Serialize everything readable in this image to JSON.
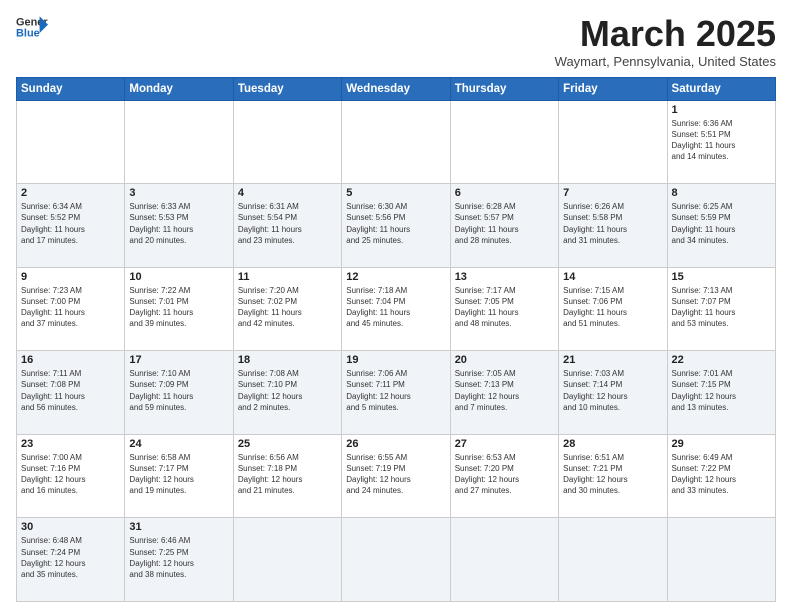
{
  "header": {
    "logo_line1": "General",
    "logo_line2": "Blue",
    "month_title": "March 2025",
    "location": "Waymart, Pennsylvania, United States"
  },
  "days_of_week": [
    "Sunday",
    "Monday",
    "Tuesday",
    "Wednesday",
    "Thursday",
    "Friday",
    "Saturday"
  ],
  "weeks": [
    {
      "days": [
        {
          "num": "",
          "info": ""
        },
        {
          "num": "",
          "info": ""
        },
        {
          "num": "",
          "info": ""
        },
        {
          "num": "",
          "info": ""
        },
        {
          "num": "",
          "info": ""
        },
        {
          "num": "",
          "info": ""
        },
        {
          "num": "1",
          "info": "Sunrise: 6:36 AM\nSunset: 5:51 PM\nDaylight: 11 hours\nand 14 minutes."
        }
      ]
    },
    {
      "days": [
        {
          "num": "2",
          "info": "Sunrise: 6:34 AM\nSunset: 5:52 PM\nDaylight: 11 hours\nand 17 minutes."
        },
        {
          "num": "3",
          "info": "Sunrise: 6:33 AM\nSunset: 5:53 PM\nDaylight: 11 hours\nand 20 minutes."
        },
        {
          "num": "4",
          "info": "Sunrise: 6:31 AM\nSunset: 5:54 PM\nDaylight: 11 hours\nand 23 minutes."
        },
        {
          "num": "5",
          "info": "Sunrise: 6:30 AM\nSunset: 5:56 PM\nDaylight: 11 hours\nand 25 minutes."
        },
        {
          "num": "6",
          "info": "Sunrise: 6:28 AM\nSunset: 5:57 PM\nDaylight: 11 hours\nand 28 minutes."
        },
        {
          "num": "7",
          "info": "Sunrise: 6:26 AM\nSunset: 5:58 PM\nDaylight: 11 hours\nand 31 minutes."
        },
        {
          "num": "8",
          "info": "Sunrise: 6:25 AM\nSunset: 5:59 PM\nDaylight: 11 hours\nand 34 minutes."
        }
      ]
    },
    {
      "days": [
        {
          "num": "9",
          "info": "Sunrise: 7:23 AM\nSunset: 7:00 PM\nDaylight: 11 hours\nand 37 minutes."
        },
        {
          "num": "10",
          "info": "Sunrise: 7:22 AM\nSunset: 7:01 PM\nDaylight: 11 hours\nand 39 minutes."
        },
        {
          "num": "11",
          "info": "Sunrise: 7:20 AM\nSunset: 7:02 PM\nDaylight: 11 hours\nand 42 minutes."
        },
        {
          "num": "12",
          "info": "Sunrise: 7:18 AM\nSunset: 7:04 PM\nDaylight: 11 hours\nand 45 minutes."
        },
        {
          "num": "13",
          "info": "Sunrise: 7:17 AM\nSunset: 7:05 PM\nDaylight: 11 hours\nand 48 minutes."
        },
        {
          "num": "14",
          "info": "Sunrise: 7:15 AM\nSunset: 7:06 PM\nDaylight: 11 hours\nand 51 minutes."
        },
        {
          "num": "15",
          "info": "Sunrise: 7:13 AM\nSunset: 7:07 PM\nDaylight: 11 hours\nand 53 minutes."
        }
      ]
    },
    {
      "days": [
        {
          "num": "16",
          "info": "Sunrise: 7:11 AM\nSunset: 7:08 PM\nDaylight: 11 hours\nand 56 minutes."
        },
        {
          "num": "17",
          "info": "Sunrise: 7:10 AM\nSunset: 7:09 PM\nDaylight: 11 hours\nand 59 minutes."
        },
        {
          "num": "18",
          "info": "Sunrise: 7:08 AM\nSunset: 7:10 PM\nDaylight: 12 hours\nand 2 minutes."
        },
        {
          "num": "19",
          "info": "Sunrise: 7:06 AM\nSunset: 7:11 PM\nDaylight: 12 hours\nand 5 minutes."
        },
        {
          "num": "20",
          "info": "Sunrise: 7:05 AM\nSunset: 7:13 PM\nDaylight: 12 hours\nand 7 minutes."
        },
        {
          "num": "21",
          "info": "Sunrise: 7:03 AM\nSunset: 7:14 PM\nDaylight: 12 hours\nand 10 minutes."
        },
        {
          "num": "22",
          "info": "Sunrise: 7:01 AM\nSunset: 7:15 PM\nDaylight: 12 hours\nand 13 minutes."
        }
      ]
    },
    {
      "days": [
        {
          "num": "23",
          "info": "Sunrise: 7:00 AM\nSunset: 7:16 PM\nDaylight: 12 hours\nand 16 minutes."
        },
        {
          "num": "24",
          "info": "Sunrise: 6:58 AM\nSunset: 7:17 PM\nDaylight: 12 hours\nand 19 minutes."
        },
        {
          "num": "25",
          "info": "Sunrise: 6:56 AM\nSunset: 7:18 PM\nDaylight: 12 hours\nand 21 minutes."
        },
        {
          "num": "26",
          "info": "Sunrise: 6:55 AM\nSunset: 7:19 PM\nDaylight: 12 hours\nand 24 minutes."
        },
        {
          "num": "27",
          "info": "Sunrise: 6:53 AM\nSunset: 7:20 PM\nDaylight: 12 hours\nand 27 minutes."
        },
        {
          "num": "28",
          "info": "Sunrise: 6:51 AM\nSunset: 7:21 PM\nDaylight: 12 hours\nand 30 minutes."
        },
        {
          "num": "29",
          "info": "Sunrise: 6:49 AM\nSunset: 7:22 PM\nDaylight: 12 hours\nand 33 minutes."
        }
      ]
    },
    {
      "days": [
        {
          "num": "30",
          "info": "Sunrise: 6:48 AM\nSunset: 7:24 PM\nDaylight: 12 hours\nand 35 minutes."
        },
        {
          "num": "31",
          "info": "Sunrise: 6:46 AM\nSunset: 7:25 PM\nDaylight: 12 hours\nand 38 minutes."
        },
        {
          "num": "",
          "info": ""
        },
        {
          "num": "",
          "info": ""
        },
        {
          "num": "",
          "info": ""
        },
        {
          "num": "",
          "info": ""
        },
        {
          "num": "",
          "info": ""
        }
      ]
    }
  ]
}
